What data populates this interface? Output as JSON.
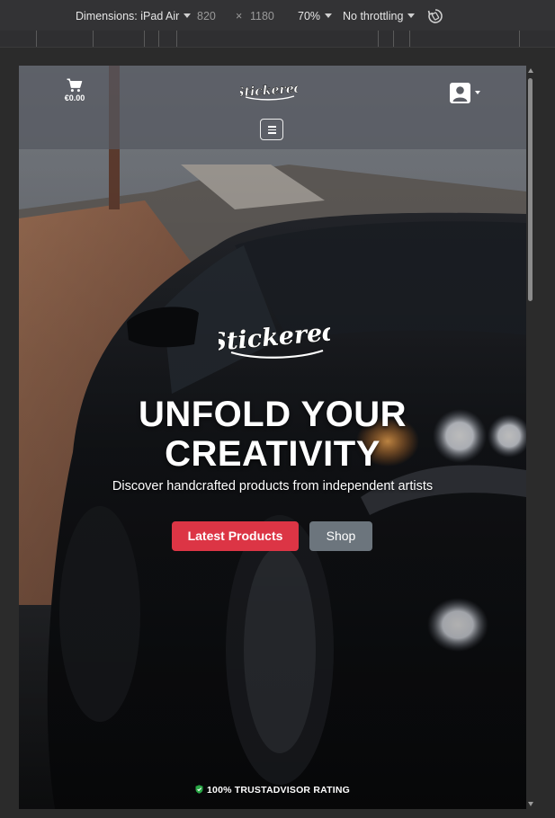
{
  "devtools": {
    "dimensions_label": "Dimensions: iPad Air",
    "width": "820",
    "times": "×",
    "height": "1180",
    "zoom": "70%",
    "throttling": "No throttling",
    "rotate_icon": "rotate-icon"
  },
  "header": {
    "cart_total": "€0.00",
    "cart_icon": "cart-icon",
    "logo_text": "Stickered",
    "account_icon": "user-icon",
    "menu_icon": "hamburger-icon"
  },
  "hero": {
    "logo_text": "Stickered",
    "title_line1": "UNFOLD YOUR",
    "title_line2": "CREATIVITY",
    "subtitle": "Discover handcrafted products from independent artists",
    "primary_button": "Latest Products",
    "secondary_button": "Shop",
    "trust_text": "100% TRUSTADVISOR RATING",
    "trust_icon": "shield-check-icon"
  },
  "colors": {
    "primary": "#dc3545",
    "secondary": "#6c757d",
    "trust_shield": "#28a745"
  }
}
